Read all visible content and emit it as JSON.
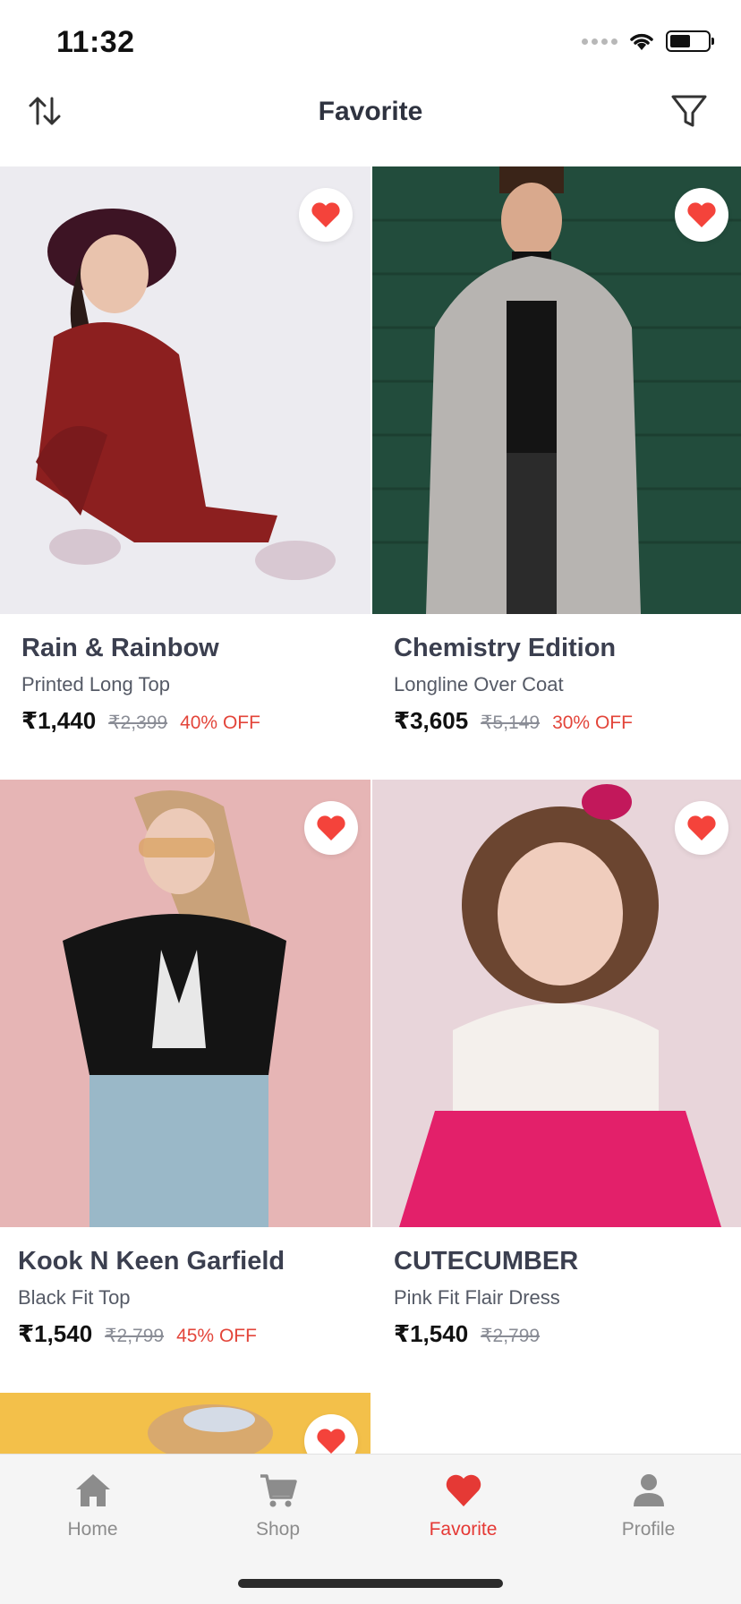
{
  "status_bar": {
    "time": "11:32"
  },
  "header": {
    "title": "Favorite"
  },
  "products": [
    {
      "brand": "Rain & Rainbow",
      "subtitle": "Printed Long Top",
      "price": "₹1,440",
      "mrp": "₹2,399",
      "discount": "40% OFF",
      "favorited": true
    },
    {
      "brand": "Chemistry Edition",
      "subtitle": "Longline Over Coat",
      "price": "₹3,605",
      "mrp": "₹5,149",
      "discount": "30% OFF",
      "favorited": true
    },
    {
      "brand": "Kook N Keen Garfield",
      "subtitle": "Black Fit Top",
      "price": "₹1,540",
      "mrp": "₹2,799",
      "discount": "45% OFF",
      "favorited": true
    },
    {
      "brand": "CUTECUMBER",
      "subtitle": "Pink Fit Flair Dress",
      "price": "₹1,540",
      "mrp": "₹2,799",
      "discount": "",
      "favorited": true
    }
  ],
  "bottom_nav": {
    "items": [
      {
        "label": "Home",
        "icon": "home-icon",
        "active": false
      },
      {
        "label": "Shop",
        "icon": "cart-icon",
        "active": false
      },
      {
        "label": "Favorite",
        "icon": "heart-icon",
        "active": true
      },
      {
        "label": "Profile",
        "icon": "person-icon",
        "active": false
      }
    ]
  },
  "colors": {
    "accent": "#e53935",
    "text": "#3b3f4f",
    "discount": "#e3453a",
    "nav_background": "#f5f5f5"
  }
}
